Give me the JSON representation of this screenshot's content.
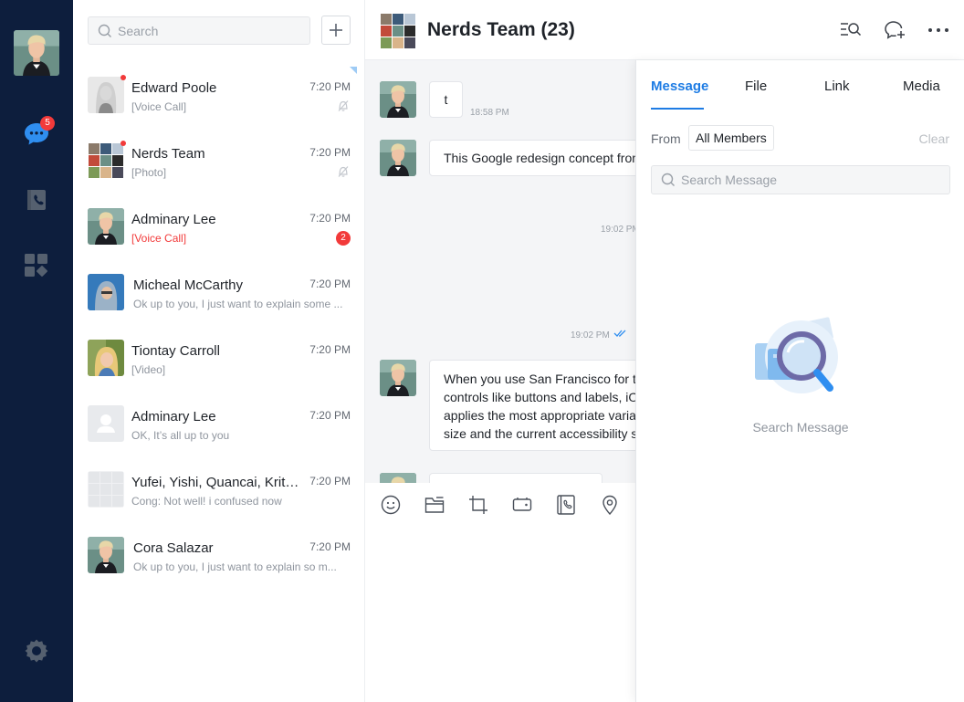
{
  "nav": {
    "chat_badge": "5"
  },
  "colors": {
    "rail_bg": "#0d1e3d",
    "accent": "#1e7ce4",
    "alert": "#f23a3a"
  },
  "sidebar": {
    "search_placeholder": "Search",
    "add_icon": "plus-icon"
  },
  "conversations": [
    {
      "name": "Edward Poole",
      "preview": "[Voice Call]",
      "time": "7:20 PM",
      "muted": true,
      "unread_dot": true,
      "pinned": true,
      "avatar": "woman-photo"
    },
    {
      "name": "Nerds Team",
      "preview": "[Photo]",
      "time": "7:20 PM",
      "muted": true,
      "unread_dot": true,
      "avatar": "group-photo"
    },
    {
      "name": "Adminary Lee",
      "preview": "[Voice Call]",
      "time": "7:20 PM",
      "alert": true,
      "unread_count": "2",
      "avatar": "man-photo"
    },
    {
      "name": "Micheal McCarthy",
      "preview": "Ok up to you, I just want to explain some ...",
      "time": "7:20 PM",
      "avatar": "hoodie-photo"
    },
    {
      "name": "Tiontay Carroll",
      "preview": "[Video]",
      "time": "7:20 PM",
      "avatar": "blonde-photo"
    },
    {
      "name": "Adminary Lee",
      "preview": "OK,  It’s all up to you",
      "time": "7:20 PM",
      "avatar": "placeholder"
    },
    {
      "name": "Yufei, Yishi, Quancai, Krit, ...",
      "preview": "Cong: Not well! i confused now",
      "time": "7:20 PM",
      "avatar": "empty-group"
    },
    {
      "name": "Cora Salazar",
      "preview": "Ok up to you, I just want to explain so m...",
      "time": "7:20 PM",
      "avatar": "man-photo"
    }
  ],
  "chat": {
    "title": "Nerds Team (23)",
    "messages": [
      {
        "text": "t",
        "time": "18:58 PM"
      },
      {
        "text": "This Google redesign concept from"
      },
      {
        "time": "19:02 PM"
      },
      {
        "time": "19:02 PM",
        "read": true
      },
      {
        "lines": [
          "When you use San Francisco for t",
          "controls like buttons and labels, iO",
          "applies the most appropriate varia",
          "size and the current accessibility s"
        ]
      }
    ]
  },
  "panel": {
    "tabs": [
      "Message",
      "File",
      "Link",
      "Media"
    ],
    "active_tab": "Message",
    "from_label": "From",
    "from_value": "All Members",
    "clear_label": "Clear",
    "search_placeholder": "Search Message",
    "empty_text": "Search Message"
  }
}
